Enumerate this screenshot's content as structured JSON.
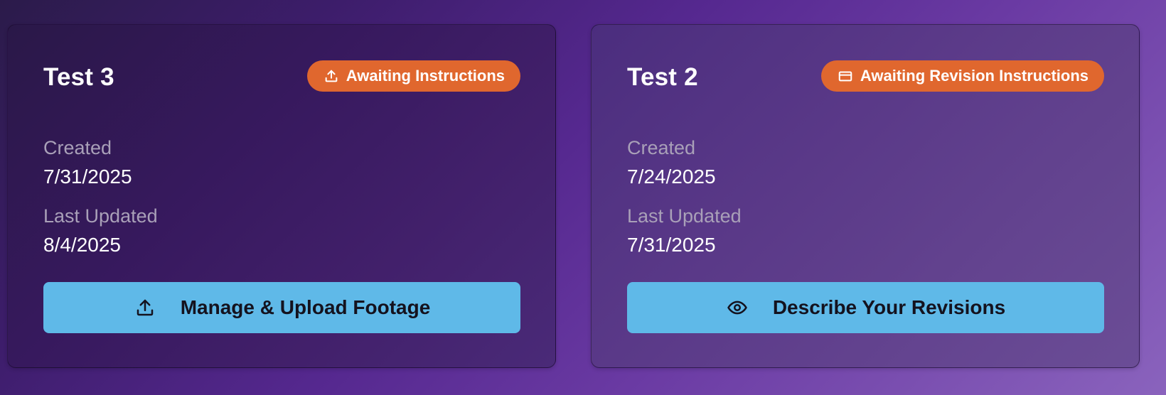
{
  "cards": [
    {
      "title": "Test 3",
      "status_badge": {
        "label": "Awaiting Instructions",
        "icon": "upload-icon",
        "color": "#e0672e"
      },
      "created_label": "Created",
      "created_value": "7/31/2025",
      "updated_label": "Last Updated",
      "updated_value": "8/4/2025",
      "action": {
        "label": "Manage & Upload Footage",
        "icon": "upload-icon"
      }
    },
    {
      "title": "Test 2",
      "status_badge": {
        "label": "Awaiting Revision Instructions",
        "icon": "credit-card-icon",
        "color": "#e0672e"
      },
      "created_label": "Created",
      "created_value": "7/24/2025",
      "updated_label": "Last Updated",
      "updated_value": "7/31/2025",
      "action": {
        "label": "Describe Your Revisions",
        "icon": "eye-icon"
      }
    }
  ],
  "colors": {
    "badge": "#e0672e",
    "action_button": "#5fb9e8"
  }
}
